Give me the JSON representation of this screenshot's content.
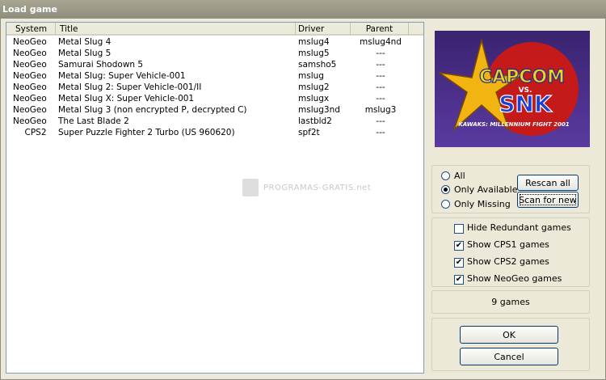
{
  "window": {
    "title": "Load game"
  },
  "columns": [
    "System",
    "Title",
    "Driver",
    "Parent"
  ],
  "games": [
    {
      "system": "NeoGeo",
      "title": "Metal Slug 4",
      "driver": "mslug4",
      "parent": "mslug4nd"
    },
    {
      "system": "NeoGeo",
      "title": "Metal Slug 5",
      "driver": "mslug5",
      "parent": "---"
    },
    {
      "system": "NeoGeo",
      "title": "Samurai Shodown 5",
      "driver": "samsho5",
      "parent": "---"
    },
    {
      "system": "NeoGeo",
      "title": "Metal Slug: Super Vehicle-001",
      "driver": "mslug",
      "parent": "---"
    },
    {
      "system": "NeoGeo",
      "title": "Metal Slug 2: Super Vehicle-001/II",
      "driver": "mslug2",
      "parent": "---"
    },
    {
      "system": "NeoGeo",
      "title": "Metal Slug X: Super Vehicle-001",
      "driver": "mslugx",
      "parent": "---"
    },
    {
      "system": "NeoGeo",
      "title": "Metal Slug 3 (non encrypted P, decrypted C)",
      "driver": "mslug3nd",
      "parent": "mslug3"
    },
    {
      "system": "NeoGeo",
      "title": "The Last Blade 2",
      "driver": "lastbld2",
      "parent": "---"
    },
    {
      "system": "CPS2",
      "title": "Super Puzzle Fighter 2 Turbo (US 960620)",
      "driver": "spf2t",
      "parent": "---"
    }
  ],
  "watermark": "PROGRAMAS-GRATIS.net",
  "logo": {
    "line1": "CAPCOM",
    "vs": "VS.",
    "line2": "SNK",
    "subtitle": "KAWAKS: MILLENNIUM FIGHT 2001"
  },
  "filter": {
    "all": "All",
    "available": "Only Available",
    "missing": "Only Missing",
    "selected": "available"
  },
  "buttons": {
    "rescan": "Rescan all",
    "scan_new": "Scan for new",
    "ok": "OK",
    "cancel": "Cancel"
  },
  "options": [
    {
      "label": "Hide Redundant games",
      "checked": false
    },
    {
      "label": "Show CPS1 games",
      "checked": true
    },
    {
      "label": "Show CPS2 games",
      "checked": true
    },
    {
      "label": "Show NeoGeo games",
      "checked": true
    }
  ],
  "count_label": "9 games"
}
